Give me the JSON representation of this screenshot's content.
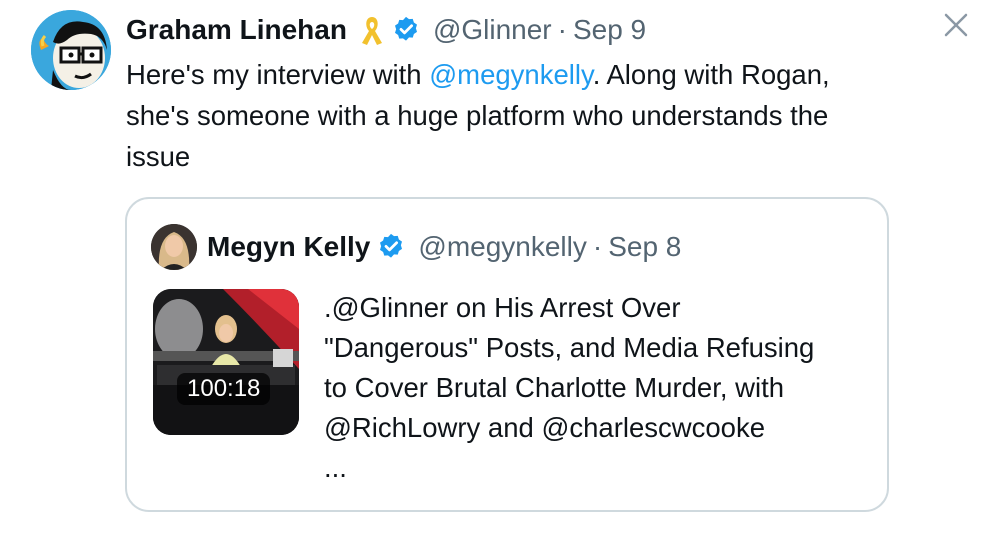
{
  "tweet": {
    "author_name": "Graham Linehan",
    "handle": "@Glinner",
    "separator": "·",
    "date": "Sep 9",
    "text_before": "Here's my interview with ",
    "mention": "@megynkelly",
    "text_after": ". Along with Rogan, she's someone with a huge platform who understands the issue"
  },
  "quote": {
    "author_name": "Megyn Kelly",
    "handle": "@megynkelly",
    "separator": "·",
    "date": "Sep 8",
    "video_duration": "100:18",
    "text_line1": ".@Glinner on His Arrest Over",
    "text_line2": "\"Dangerous\" Posts, and Media Refusing",
    "text_line3": "to Cover Brutal Charlotte Murder, with",
    "text_line4": "@RichLowry and @charlescwcooke",
    "ellipsis": "..."
  },
  "icons": {
    "ribbon": "ribbon-icon",
    "verified": "verified-badge-icon",
    "close": "close-icon"
  },
  "colors": {
    "link": "#1d9bf0",
    "secondary_text": "#536471",
    "border": "#cfd9de",
    "ribbon": "#f2c12e"
  }
}
